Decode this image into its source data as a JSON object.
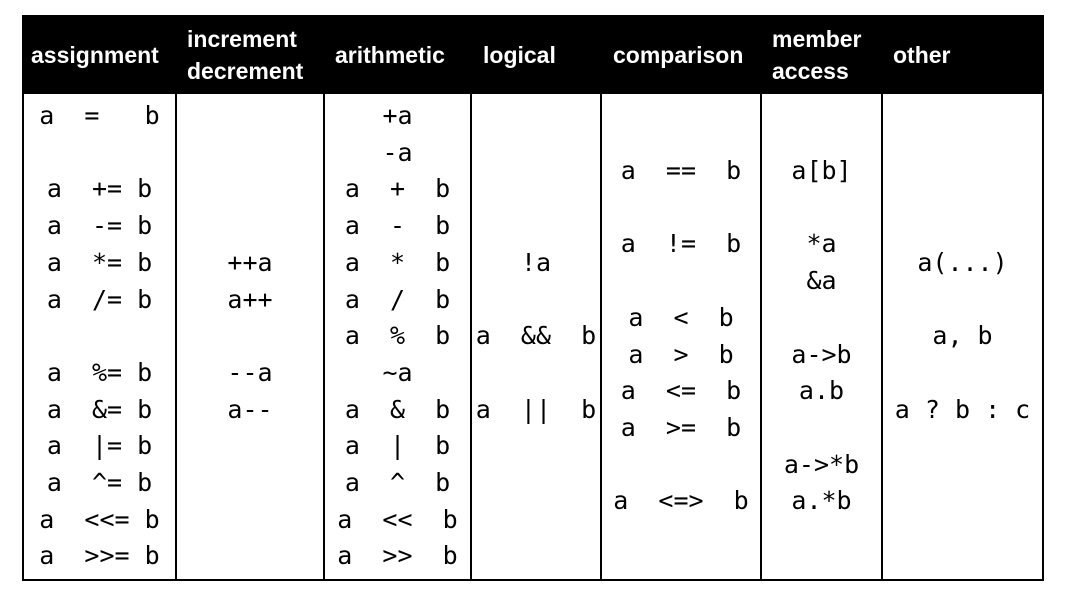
{
  "table": {
    "columns": [
      {
        "header": [
          "assignment"
        ],
        "items": [
          {
            "text": "a  =   b",
            "row": 0
          },
          {
            "text": "a  += b",
            "row": 2
          },
          {
            "text": "a  -= b",
            "row": 3
          },
          {
            "text": "a  *= b",
            "row": 4
          },
          {
            "text": "a  /= b",
            "row": 5
          },
          {
            "text": "a  %= b",
            "row": 7
          },
          {
            "text": "a  &= b",
            "row": 8
          },
          {
            "text": "a  |= b",
            "row": 9
          },
          {
            "text": "a  ^= b",
            "row": 10
          },
          {
            "text": "a  <<= b",
            "row": 11
          },
          {
            "text": "a  >>= b",
            "row": 12
          }
        ]
      },
      {
        "header": [
          "increment",
          "decrement"
        ],
        "items": [
          {
            "text": "++a",
            "row": 4
          },
          {
            "text": "a++",
            "row": 5
          },
          {
            "text": "--a",
            "row": 7
          },
          {
            "text": "a--",
            "row": 8
          }
        ]
      },
      {
        "header": [
          "arithmetic"
        ],
        "items": [
          {
            "text": "+a",
            "row": 0
          },
          {
            "text": "-a",
            "row": 1
          },
          {
            "text": "a  +  b",
            "row": 2
          },
          {
            "text": "a  -  b",
            "row": 3
          },
          {
            "text": "a  *  b",
            "row": 4
          },
          {
            "text": "a  /  b",
            "row": 5
          },
          {
            "text": "a  %  b",
            "row": 6
          },
          {
            "text": "~a",
            "row": 7
          },
          {
            "text": "a  &  b",
            "row": 8
          },
          {
            "text": "a  |  b",
            "row": 9
          },
          {
            "text": "a  ^  b",
            "row": 10
          },
          {
            "text": "a  <<  b",
            "row": 11
          },
          {
            "text": "a  >>  b",
            "row": 12
          }
        ]
      },
      {
        "header": [
          "logical"
        ],
        "items": [
          {
            "text": "!a",
            "row": 4
          },
          {
            "text": "a  &&  b",
            "row": 6
          },
          {
            "text": "a  ||  b",
            "row": 8
          }
        ]
      },
      {
        "header": [
          "comparison"
        ],
        "items": [
          {
            "text": "a  ==  b",
            "row": 1.5
          },
          {
            "text": "a  !=  b",
            "row": 3.5
          },
          {
            "text": "a  <  b",
            "row": 5.5
          },
          {
            "text": "a  >  b",
            "row": 6.5
          },
          {
            "text": "a  <=  b",
            "row": 7.5
          },
          {
            "text": "a  >=  b",
            "row": 8.5
          },
          {
            "text": "a  <=>  b",
            "row": 10.5
          }
        ]
      },
      {
        "header": [
          "member",
          "access"
        ],
        "items": [
          {
            "text": "a[b]",
            "row": 1.5
          },
          {
            "text": "*a",
            "row": 3.5
          },
          {
            "text": "&a",
            "row": 4.5
          },
          {
            "text": "a->b",
            "row": 6.5
          },
          {
            "text": "a.b",
            "row": 7.5
          },
          {
            "text": "a->*b",
            "row": 9.5
          },
          {
            "text": "a.*b",
            "row": 10.5
          }
        ]
      },
      {
        "header": [
          "other"
        ],
        "items": [
          {
            "text": "a(...)",
            "row": 4
          },
          {
            "text": "a, b",
            "row": 6
          },
          {
            "text": "a ? b : c",
            "row": 8
          }
        ]
      }
    ]
  }
}
